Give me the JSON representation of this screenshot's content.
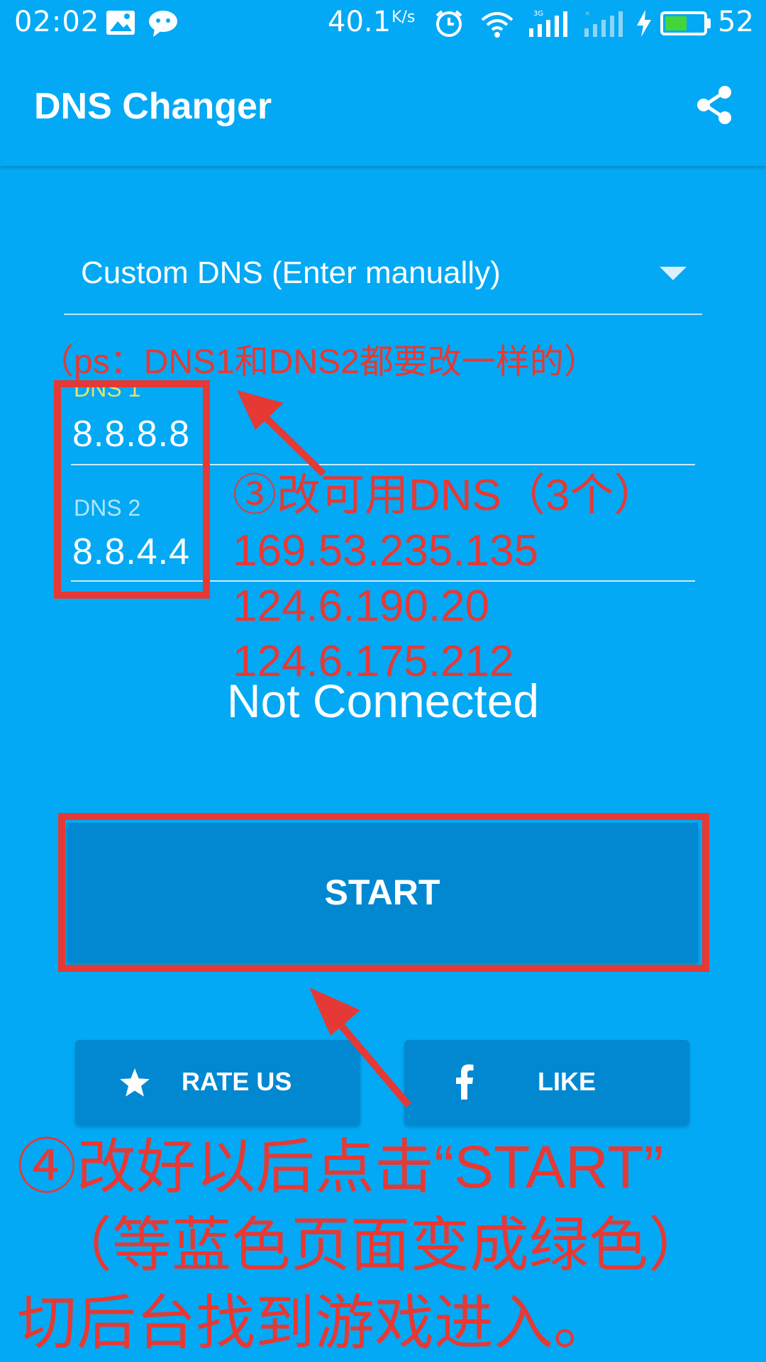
{
  "status_bar": {
    "time": "02:02",
    "speed": "40.1",
    "speed_unit": "K/s",
    "battery": "52"
  },
  "app_bar": {
    "title": "DNS Changer"
  },
  "dropdown": {
    "selected": "Custom DNS (Enter manually)"
  },
  "dns1": {
    "label": "DNS 1",
    "value": "8.8.8.8"
  },
  "dns2": {
    "label": "DNS 2",
    "value": "8.8.4.4"
  },
  "connection_status": "Not Connected",
  "start_button": {
    "label": "START"
  },
  "rate_button": {
    "label": "RATE US"
  },
  "like_button": {
    "label": "LIKE"
  },
  "annotations": {
    "ps": "（ps：DNS1和DNS2都要改一样的）",
    "step3": [
      "③改可用DNS（3个）",
      "169.53.235.135",
      "124.6.190.20",
      "124.6.175.212"
    ],
    "step4": [
      "④改好以后点击“START”",
      "（等蓝色页面变成绿色）",
      "切后台找到游戏进入。"
    ]
  },
  "colors": {
    "background": "#03a9f4",
    "button": "#0288d1",
    "annotation_red": "#e53935",
    "dns1_label_focused": "#e8e06a",
    "dns2_label": "#b3e5fc",
    "battery_green": "#43d63a"
  }
}
